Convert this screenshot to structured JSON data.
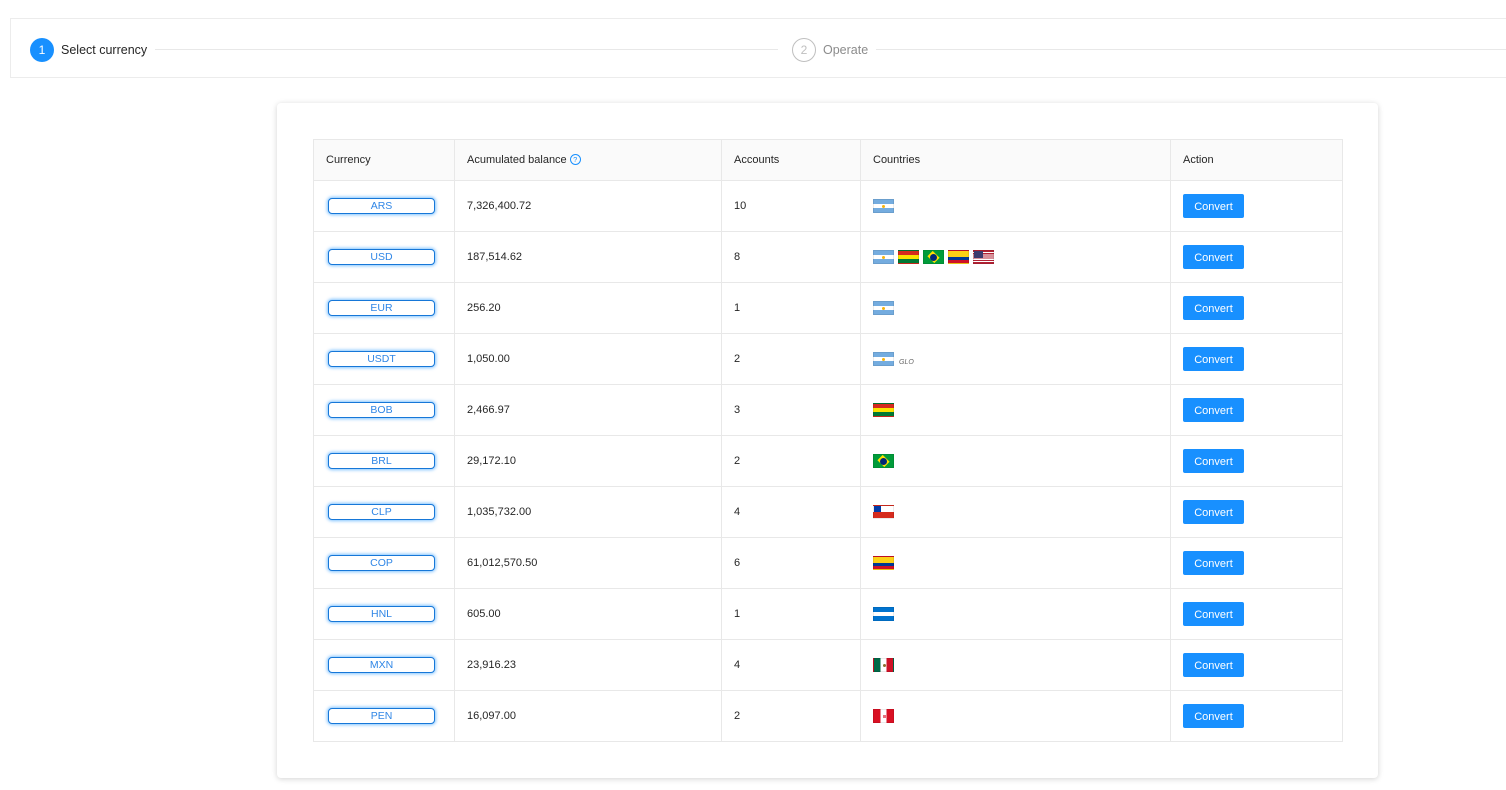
{
  "steps": [
    {
      "number": "1",
      "label": "Select currency",
      "status": "active"
    },
    {
      "number": "2",
      "label": "Operate",
      "status": "inactive"
    }
  ],
  "table": {
    "headers": {
      "currency": "Currency",
      "balance": "Acumulated balance",
      "accounts": "Accounts",
      "countries": "Countries",
      "action": "Action"
    },
    "help_icon": "?",
    "action_label": "Convert",
    "rows": [
      {
        "currency": "ARS",
        "balance": "7,326,400.72",
        "accounts": "10",
        "flags": [
          "ar"
        ]
      },
      {
        "currency": "USD",
        "balance": "187,514.62",
        "accounts": "8",
        "flags": [
          "ar",
          "bo",
          "br",
          "co",
          "us"
        ]
      },
      {
        "currency": "EUR",
        "balance": "256.20",
        "accounts": "1",
        "flags": [
          "ar"
        ]
      },
      {
        "currency": "USDT",
        "balance": "1,050.00",
        "accounts": "2",
        "flags": [
          "ar"
        ],
        "extra": "GLO"
      },
      {
        "currency": "BOB",
        "balance": "2,466.97",
        "accounts": "3",
        "flags": [
          "bo"
        ]
      },
      {
        "currency": "BRL",
        "balance": "29,172.10",
        "accounts": "2",
        "flags": [
          "br"
        ]
      },
      {
        "currency": "CLP",
        "balance": "1,035,732.00",
        "accounts": "4",
        "flags": [
          "cl"
        ]
      },
      {
        "currency": "COP",
        "balance": "61,012,570.50",
        "accounts": "6",
        "flags": [
          "co"
        ]
      },
      {
        "currency": "HNL",
        "balance": "605.00",
        "accounts": "1",
        "flags": [
          "hn"
        ]
      },
      {
        "currency": "MXN",
        "balance": "23,916.23",
        "accounts": "4",
        "flags": [
          "mx"
        ]
      },
      {
        "currency": "PEN",
        "balance": "16,097.00",
        "accounts": "2",
        "flags": [
          "pe"
        ]
      }
    ]
  },
  "colors": {
    "primary": "#1890ff",
    "border": "#e8e8e8",
    "header_bg": "#fafafa"
  }
}
